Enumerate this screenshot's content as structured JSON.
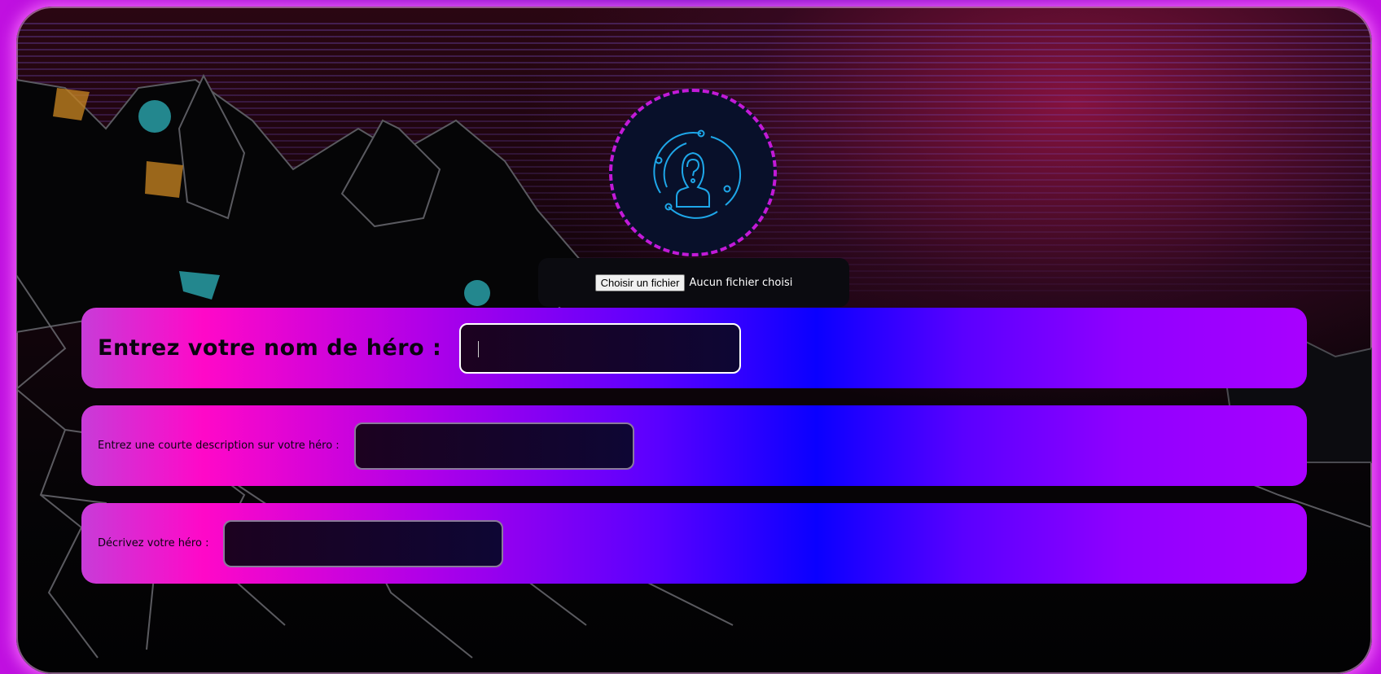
{
  "avatar": {
    "icon": "unknown-hero-question-icon"
  },
  "file_input": {
    "button_label": "Choisir un fichier",
    "status": "Aucun fichier choisi"
  },
  "hero_name": {
    "label": "Entrez votre nom de héro :",
    "value": ""
  },
  "short_description": {
    "label": "Entrez une courte description sur votre héro :",
    "value": ""
  },
  "describe": {
    "label": "Décrivez votre héro :",
    "value": ""
  },
  "colors": {
    "accent_pink": "#ff08c8",
    "accent_blue": "#0a00ff",
    "accent_purple": "#a800ff",
    "avatar_border": "#c21ad8"
  }
}
